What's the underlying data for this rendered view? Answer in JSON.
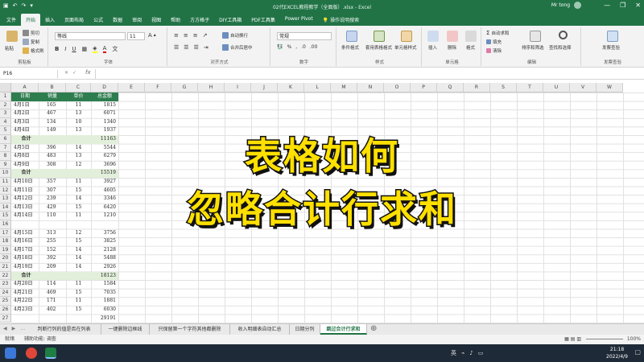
{
  "window": {
    "title": "02代EXCEL教程教学（全面版）.xlsx - Excel",
    "user": "Mr tong",
    "controls": [
      "—",
      "❐",
      "✕"
    ]
  },
  "tabs": [
    "文件",
    "开始",
    "插入",
    "页面布局",
    "公式",
    "数据",
    "审阅",
    "视图",
    "帮助",
    "方方格子",
    "DIY工具箱",
    "PDF工具集",
    "Power Pivot"
  ],
  "active_tab": "开始",
  "tell_me": "操作说明搜索",
  "ribbon": {
    "clipboard": {
      "label": "剪贴板",
      "paste": "粘贴",
      "cut": "剪切",
      "copy": "复制",
      "format_painter": "格式刷"
    },
    "font": {
      "label": "字体",
      "name": "等线",
      "size": "11"
    },
    "alignment": {
      "label": "对齐方式",
      "wrap": "自动换行",
      "merge": "合并后居中"
    },
    "number": {
      "label": "数字",
      "format": "常规"
    },
    "styles": {
      "label": "样式",
      "conditional": "条件格式",
      "table": "套用表格格式",
      "cell_styles": "单元格样式"
    },
    "cells": {
      "label": "单元格",
      "insert": "插入",
      "delete": "删除",
      "format": "格式"
    },
    "editing": {
      "label": "编辑",
      "autosum": "自动求和",
      "fill": "填充",
      "clear": "清除",
      "sort": "排序和筛选",
      "find": "查找和选择"
    },
    "invoice": {
      "label": "发票查验",
      "btn": "发票查验"
    }
  },
  "name_box": "P16",
  "fx": "fx",
  "columns": [
    "A",
    "B",
    "C",
    "D",
    "E",
    "F",
    "G",
    "H",
    "I",
    "J",
    "K",
    "L",
    "M",
    "N",
    "O",
    "P",
    "Q",
    "R",
    "S",
    "T",
    "U",
    "V",
    "W"
  ],
  "rows": [
    "1",
    "2",
    "3",
    "4",
    "5",
    "6",
    "7",
    "8",
    "9",
    "10",
    "11",
    "12",
    "13",
    "14",
    "15",
    "16",
    "17",
    "18",
    "19",
    "20",
    "21",
    "22",
    "23",
    "24",
    "25",
    "26",
    "27"
  ],
  "table": {
    "headers": [
      "日期",
      "销量",
      "单价",
      "总金额"
    ],
    "rows": [
      [
        "4月1日",
        "165",
        "11",
        "1815"
      ],
      [
        "4月2日",
        "467",
        "13",
        "6071"
      ],
      [
        "4月3日",
        "134",
        "10",
        "1340"
      ],
      [
        "4月4日",
        "149",
        "13",
        "1937"
      ],
      [
        "合计",
        "",
        "",
        "11163"
      ],
      [
        "4月5日",
        "396",
        "14",
        "5544"
      ],
      [
        "4月8日",
        "483",
        "13",
        "6279"
      ],
      [
        "4月9日",
        "308",
        "12",
        "3696"
      ],
      [
        "合计",
        "",
        "",
        "15519"
      ],
      [
        "4月10日",
        "357",
        "11",
        "3927"
      ],
      [
        "4月11日",
        "307",
        "15",
        "4605"
      ],
      [
        "4月12日",
        "239",
        "14",
        "3346"
      ],
      [
        "4月13日",
        "429",
        "15",
        "6420"
      ],
      [
        "4月14日",
        "110",
        "11",
        "1210"
      ],
      [
        "",
        "",
        "",
        ""
      ],
      [
        "4月15日",
        "313",
        "12",
        "3756"
      ],
      [
        "4月16日",
        "255",
        "15",
        "3825"
      ],
      [
        "4月17日",
        "152",
        "14",
        "2128"
      ],
      [
        "4月18日",
        "392",
        "14",
        "5488"
      ],
      [
        "4月19日",
        "209",
        "14",
        "2926"
      ],
      [
        "合计",
        "",
        "",
        "18123"
      ],
      [
        "4月20日",
        "114",
        "11",
        "1584"
      ],
      [
        "4月21日",
        "469",
        "15",
        "7035"
      ],
      [
        "4月22日",
        "171",
        "11",
        "1881"
      ],
      [
        "4月23日",
        "402",
        "15",
        "6030"
      ],
      [
        "",
        "",
        "",
        "29191"
      ]
    ]
  },
  "overlay": {
    "line1": "表格如何",
    "line2": "忽略合计行求和"
  },
  "sheet_tabs": [
    "判断行列的值是否在列表",
    "一键删除边框线",
    "只保留第一个字符其他都删除",
    "收入明细表自动汇总",
    "日期分列",
    "跳过合计行求和"
  ],
  "active_sheet": "跳过合计行求和",
  "status": {
    "ready": "就绪",
    "accessibility": "辅助功能: 调查",
    "zoom": "100%"
  },
  "taskbar": {
    "time": "21:18",
    "date": "2022/4/9"
  }
}
